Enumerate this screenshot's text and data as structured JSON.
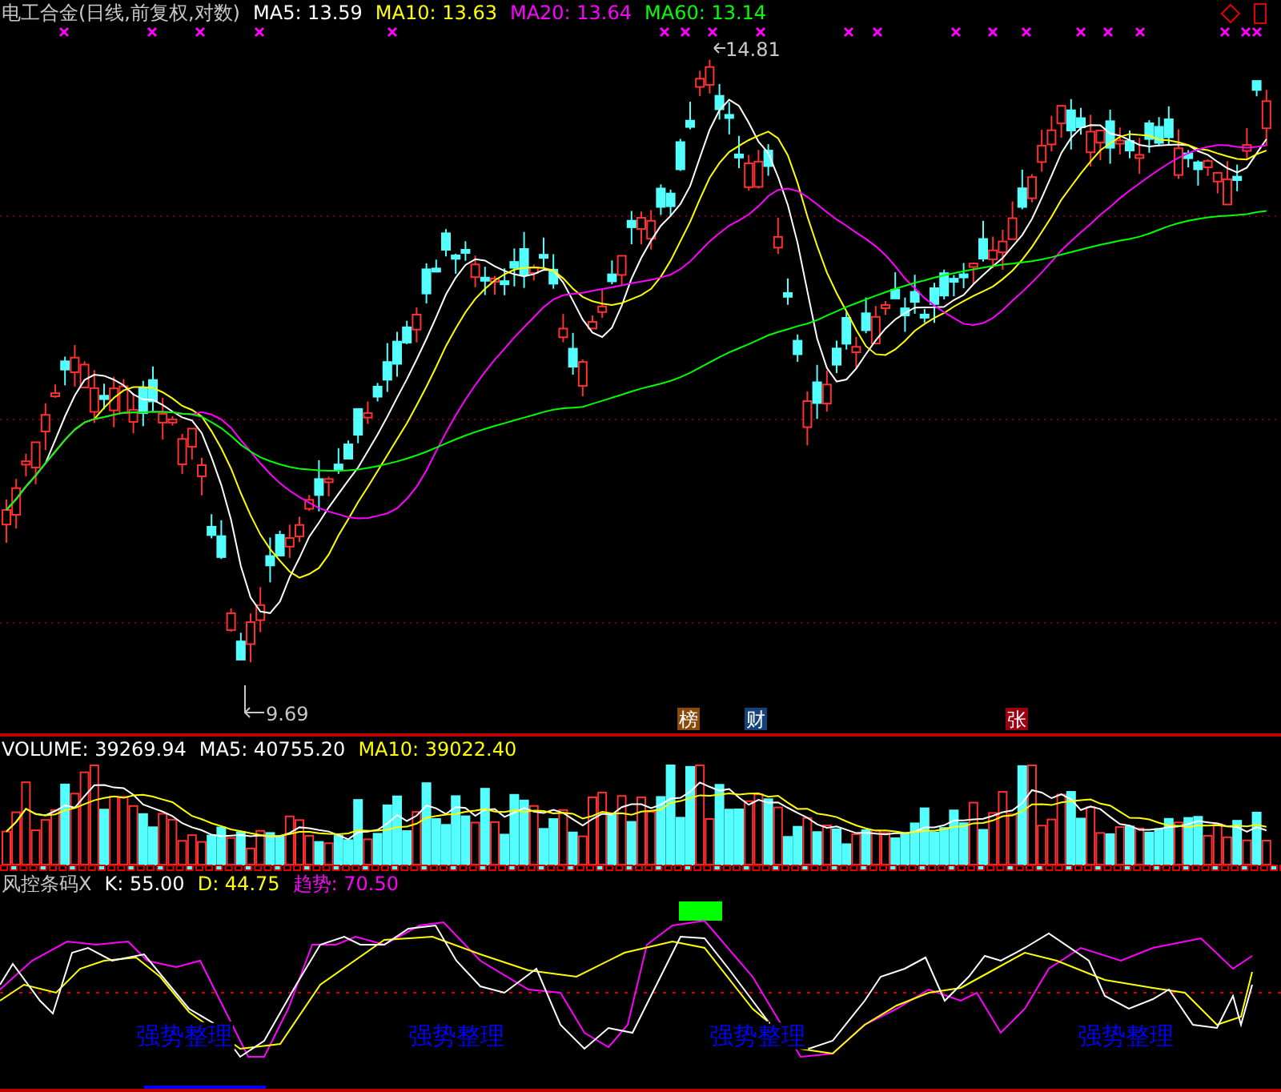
{
  "header": {
    "title": "电工合金(日线,前复权,对数)",
    "indicators": [
      {
        "label": "MA5: 13.59",
        "color": "#ffffff"
      },
      {
        "label": "MA10: 13.63",
        "color": "#ffff00"
      },
      {
        "label": "MA20: 13.64",
        "color": "#ff00ff"
      },
      {
        "label": "MA60: 13.14",
        "color": "#00ff00"
      }
    ]
  },
  "price_chart": {
    "high_label": "14.81",
    "low_label": "9.69",
    "badges": [
      {
        "text": "榜",
        "color": "#8a4a0e"
      },
      {
        "text": "财",
        "color": "#15427a"
      },
      {
        "text": "张",
        "color": "#9a0010"
      }
    ]
  },
  "volume": {
    "indicators": [
      {
        "label": "VOLUME: 39269.94",
        "color": "#ffffff"
      },
      {
        "label": "MA5: 40755.20",
        "color": "#ffffff"
      },
      {
        "label": "MA10: 39022.40",
        "color": "#ffff00"
      }
    ]
  },
  "oscillator": {
    "name": "风控条码X",
    "indicators": [
      {
        "label": "K: 55.00",
        "color": "#ffffff"
      },
      {
        "label": "D: 44.75",
        "color": "#ffff00"
      },
      {
        "label": "趋势: 70.50",
        "color": "#ff00ff"
      }
    ],
    "signals": [
      "强势整理",
      "强势整理",
      "强势整理",
      "强势整理"
    ]
  }
}
